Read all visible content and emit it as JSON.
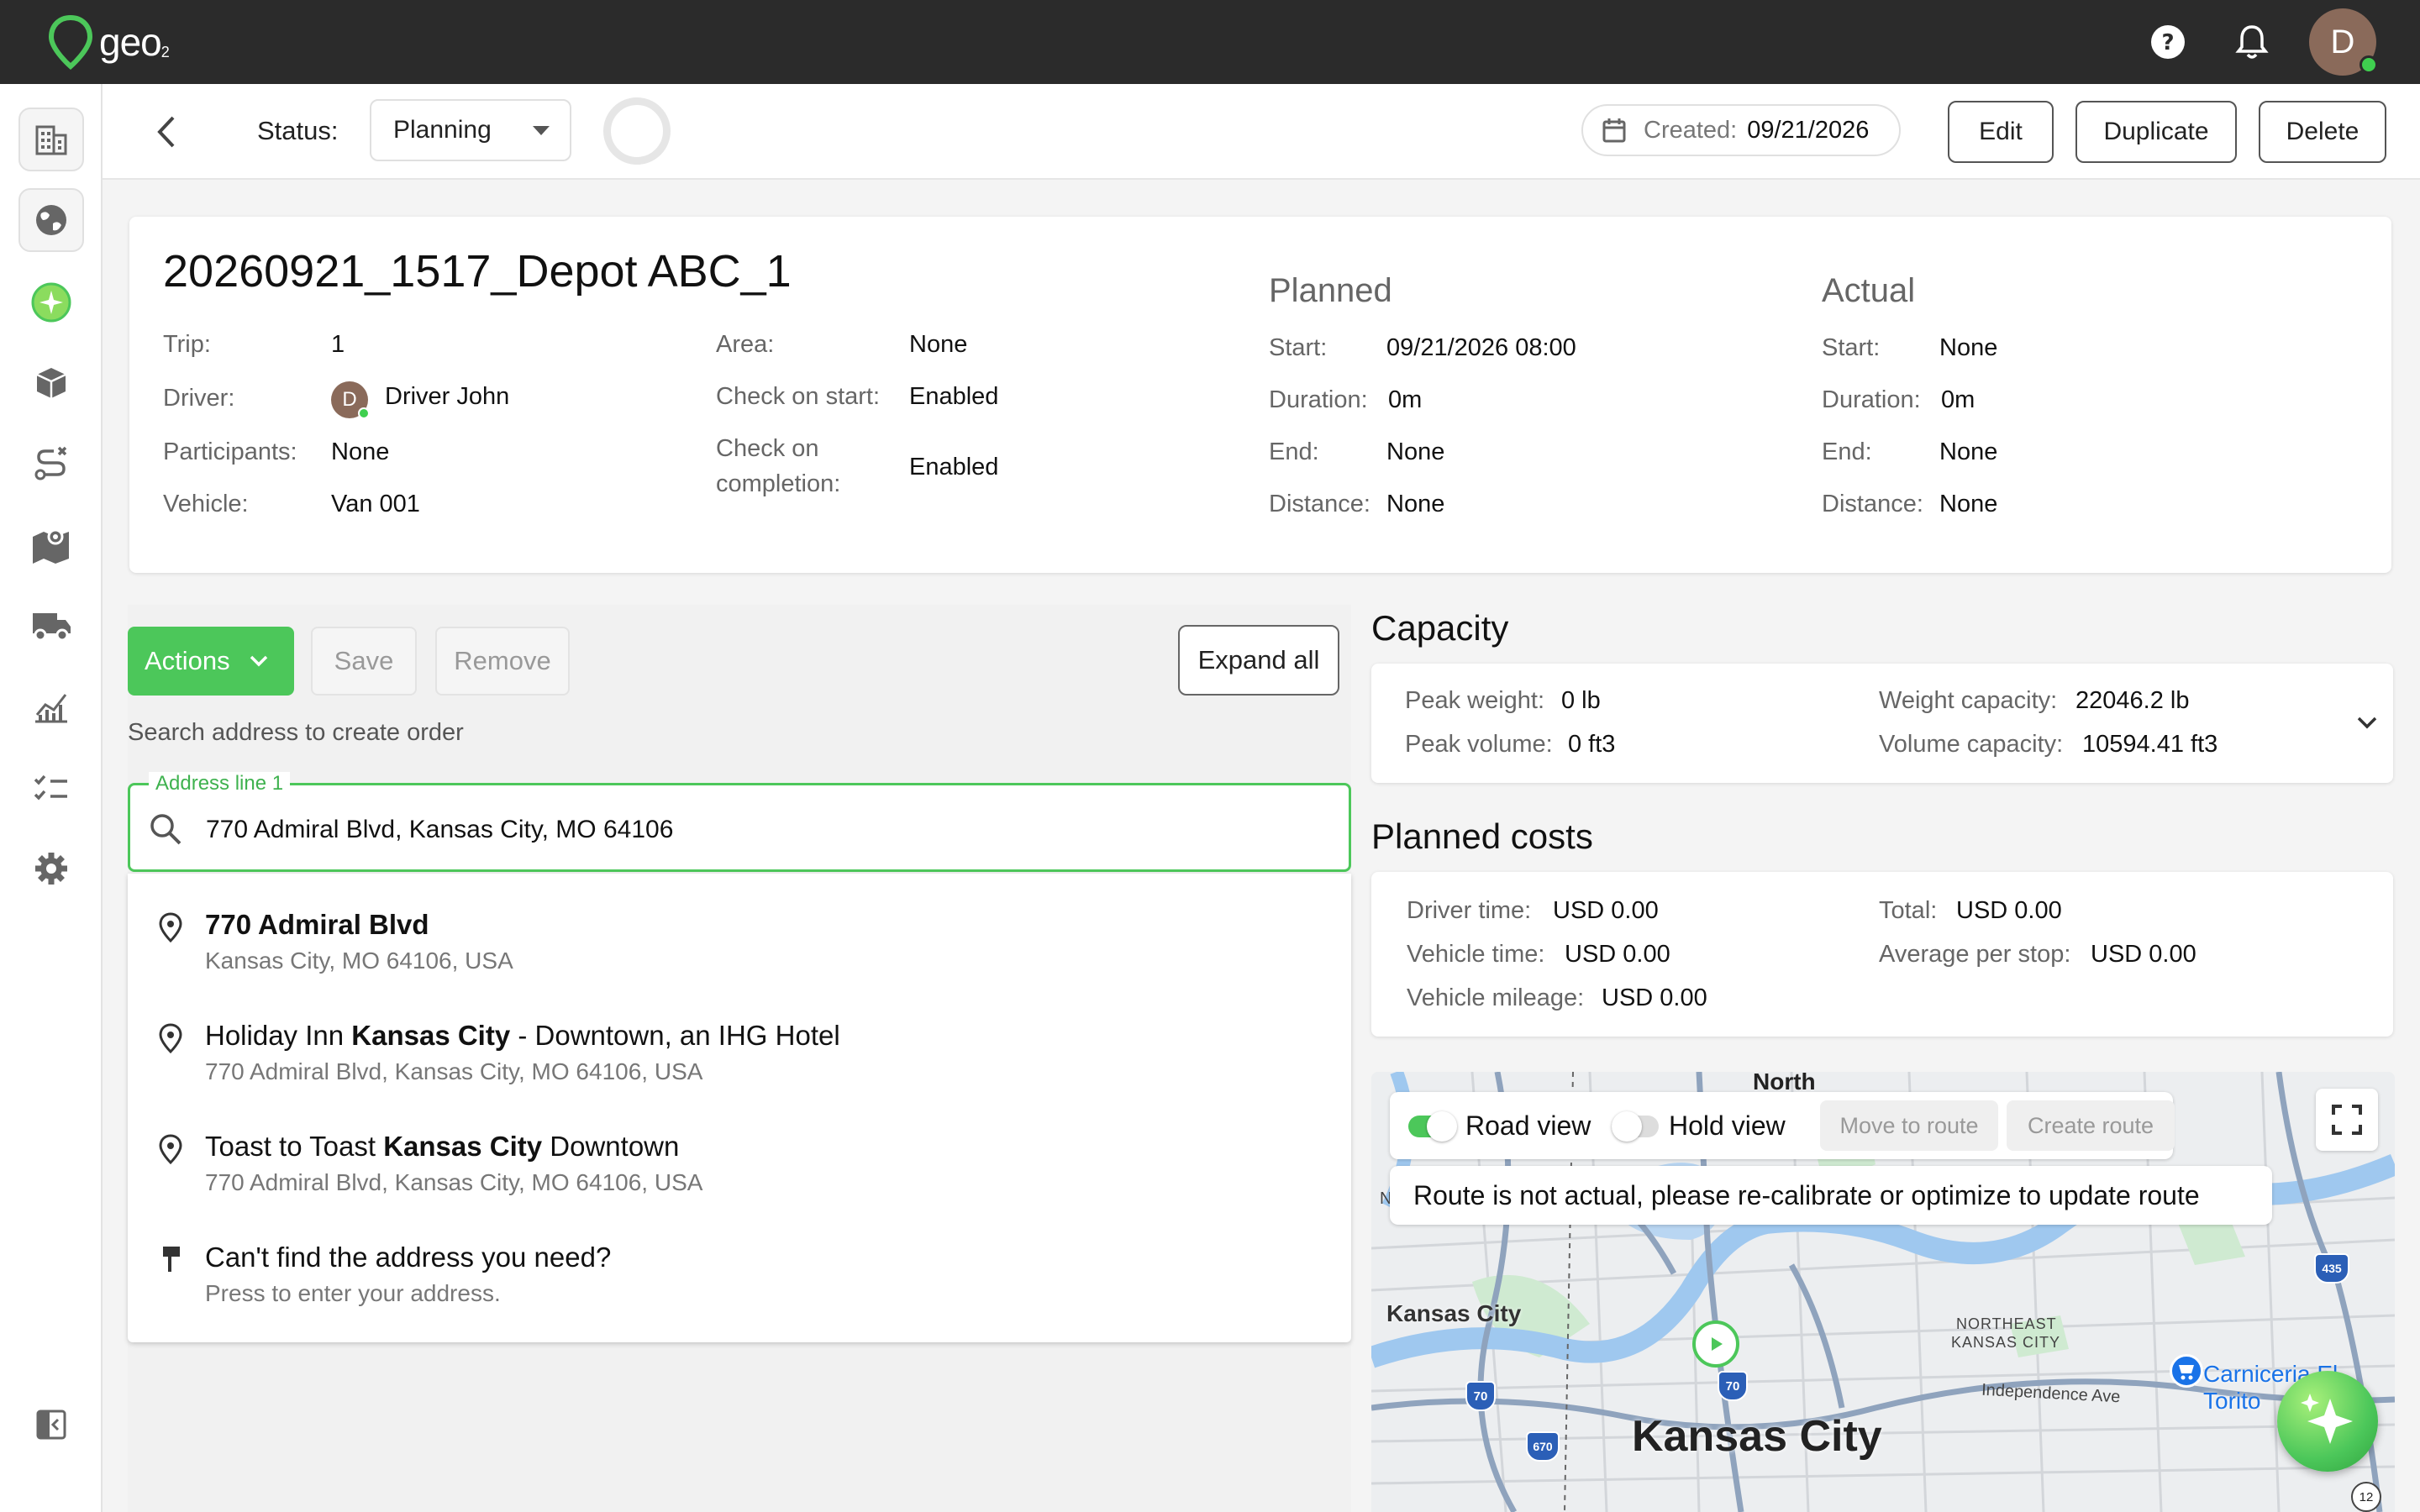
{
  "app": {
    "logo_text": "geo",
    "logo_sub": "2",
    "user_initial": "D",
    "accent": "#4cc75a"
  },
  "sidebar": {
    "items": [
      {
        "name": "organizations",
        "icon": "building-icon"
      },
      {
        "name": "globe",
        "icon": "globe-icon"
      },
      {
        "name": "ai-globe",
        "icon": "sparkle-globe-icon"
      },
      {
        "name": "orders",
        "icon": "package-icon"
      },
      {
        "name": "routes",
        "icon": "route-icon"
      },
      {
        "name": "map",
        "icon": "map-icon"
      },
      {
        "name": "vehicles",
        "icon": "truck-icon"
      },
      {
        "name": "analytics",
        "icon": "chart-icon"
      },
      {
        "name": "tasks",
        "icon": "checklist-icon"
      },
      {
        "name": "settings",
        "icon": "gear-icon"
      }
    ]
  },
  "header": {
    "status_label": "Status:",
    "status_value": "Planning",
    "created_label": "Created:",
    "created_value": "09/21/2026",
    "edit_label": "Edit",
    "duplicate_label": "Duplicate",
    "delete_label": "Delete"
  },
  "trip": {
    "title": "20260921_1517_Depot ABC_1",
    "trip_label": "Trip:",
    "trip_value": "1",
    "driver_label": "Driver:",
    "driver_initial": "D",
    "driver_value": "Driver John",
    "participants_label": "Participants:",
    "participants_value": "None",
    "vehicle_label": "Vehicle:",
    "vehicle_value": "Van 001",
    "area_label": "Area:",
    "area_value": "None",
    "check_start_label": "Check on start:",
    "check_start_value": "Enabled",
    "check_completion_label_1": "Check on",
    "check_completion_label_2": "completion:",
    "check_completion_value": "Enabled"
  },
  "planned": {
    "heading": "Planned",
    "start_label": "Start:",
    "start_value": "09/21/2026 08:00",
    "duration_label": "Duration:",
    "duration_value": "0m",
    "end_label": "End:",
    "end_value": "None",
    "distance_label": "Distance:",
    "distance_value": "None"
  },
  "actual": {
    "heading": "Actual",
    "start_label": "Start:",
    "start_value": "None",
    "duration_label": "Duration:",
    "duration_value": "0m",
    "end_label": "End:",
    "end_value": "None",
    "distance_label": "Distance:",
    "distance_value": "None"
  },
  "orders": {
    "actions_label": "Actions",
    "save_label": "Save",
    "remove_label": "Remove",
    "expand_label": "Expand all",
    "search_hint": "Search address to create order",
    "address_legend": "Address line 1",
    "address_value": "770 Admiral Blvd, Kansas City, MO 64106",
    "suggestions": [
      {
        "pre": "",
        "bold": "770 Admiral Blvd",
        "post": "",
        "sub": "Kansas City, MO 64106, USA"
      },
      {
        "pre": "Holiday Inn ",
        "bold": "Kansas City",
        "post": " - Downtown, an IHG Hotel",
        "sub": "770 Admiral Blvd, Kansas City, MO 64106, USA"
      },
      {
        "pre": "Toast to Toast ",
        "bold": "Kansas City",
        "post": " Downtown",
        "sub": "770 Admiral Blvd, Kansas City, MO 64106, USA"
      }
    ],
    "manual_main": "Can't find the address you need?",
    "manual_sub": "Press to enter your address."
  },
  "capacity": {
    "heading": "Capacity",
    "peak_weight_label": "Peak weight:",
    "peak_weight_value": "0 lb",
    "peak_volume_label": "Peak volume:",
    "peak_volume_value": "0 ft3",
    "weight_cap_label": "Weight capacity:",
    "weight_cap_value": "22046.2 lb",
    "volume_cap_label": "Volume capacity:",
    "volume_cap_value": "10594.41 ft3"
  },
  "costs": {
    "heading": "Planned costs",
    "driver_time_label": "Driver time:",
    "driver_time_value": "USD 0.00",
    "vehicle_time_label": "Vehicle time:",
    "vehicle_time_value": "USD 0.00",
    "vehicle_mileage_label": "Vehicle mileage:",
    "vehicle_mileage_value": "USD 0.00",
    "total_label": "Total:",
    "total_value": "USD 0.00",
    "avg_label": "Average per stop:",
    "avg_value": "USD 0.00"
  },
  "map": {
    "road_view_label": "Road view",
    "road_view_on": true,
    "hold_view_label": "Hold view",
    "hold_view_on": false,
    "move_to_route_label": "Move to route",
    "create_route_label": "Create route",
    "notice": "Route is not actual, please re-calibrate or optimize to update route",
    "labels": {
      "north": "North",
      "kc_small": "Kansas City",
      "kc_big": "Kansas City",
      "ne_kc_1": "NORTHEAST",
      "ne_kc_2": "KANSAS CITY",
      "independence": "Independence Ave",
      "poi": "Carniceria El Torito",
      "i70": "70",
      "i70b": "70",
      "i670": "670",
      "i435": "435",
      "r12": "12",
      "n_edge": "N"
    }
  }
}
